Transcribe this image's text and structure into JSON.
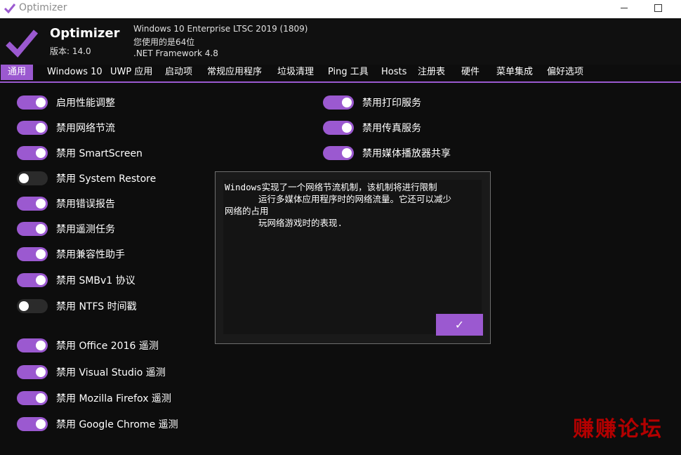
{
  "window": {
    "title": "Optimizer"
  },
  "header": {
    "app_name": "Optimizer",
    "version": "版本: 14.0",
    "os": "Windows 10 Enterprise LTSC 2019 (1809)",
    "arch": "您使用的是64位",
    "framework": ".NET Framework 4.8"
  },
  "tabs": [
    {
      "label": "通用",
      "active": true
    },
    {
      "label": "Windows 10"
    },
    {
      "label": "UWP 应用"
    },
    {
      "label": "启动项"
    },
    {
      "label": "常规应用程序"
    },
    {
      "label": "垃圾清理"
    },
    {
      "label": "Ping 工具"
    },
    {
      "label": "Hosts"
    },
    {
      "label": "注册表"
    },
    {
      "label": "硬件"
    },
    {
      "label": "菜单集成"
    },
    {
      "label": "偏好选项"
    }
  ],
  "left_toggles": [
    {
      "label": "启用性能调整",
      "on": true
    },
    {
      "label": "禁用网络节流",
      "on": true
    },
    {
      "label": "禁用 SmartScreen",
      "on": true
    },
    {
      "label": "禁用 System Restore",
      "on": false
    },
    {
      "label": "禁用错误报告",
      "on": true
    },
    {
      "label": "禁用遥测任务",
      "on": true
    },
    {
      "label": "禁用兼容性助手",
      "on": true
    },
    {
      "label": "禁用 SMBv1 协议",
      "on": true
    },
    {
      "label": "禁用 NTFS 时间戳",
      "on": false
    },
    {
      "label": "禁用 Office 2016 遥测",
      "on": true
    },
    {
      "label": "禁用 Visual Studio 遥测",
      "on": true
    },
    {
      "label": "禁用 Mozilla Firefox 遥测",
      "on": true
    },
    {
      "label": "禁用 Google Chrome 遥测",
      "on": true
    }
  ],
  "right_toggles": [
    {
      "label": "禁用打印服务",
      "on": true
    },
    {
      "label": "禁用传真服务",
      "on": true
    },
    {
      "label": "禁用媒体播放器共享",
      "on": true
    }
  ],
  "dialog": {
    "lines": [
      "Windows实现了一个网络节流机制，该机制将进行限制",
      "运行多媒体应用程序时的网络流量。它还可以减少",
      "网络的占用",
      "玩网络游戏时的表现."
    ],
    "ok_label": "✓"
  },
  "watermark": "赚赚论坛",
  "colors": {
    "accent": "#9b59d0",
    "background": "#0d0d0d",
    "toggle_off": "#2b2b2b",
    "watermark": "#b30000"
  },
  "icons": {
    "app": "checkmark-icon"
  }
}
